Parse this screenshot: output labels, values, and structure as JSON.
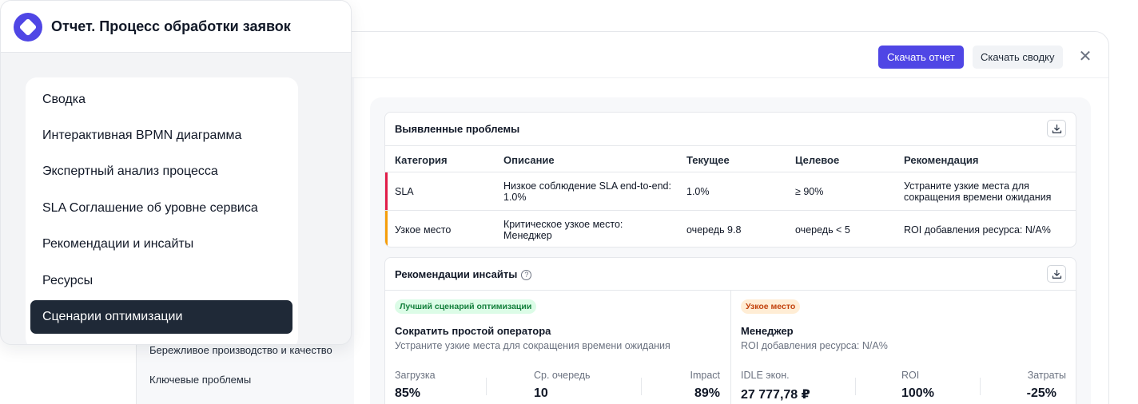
{
  "menu": {
    "title": "Отчет. Процесс обработки заявок",
    "items": [
      {
        "label": "Сводка"
      },
      {
        "label": "Интерактивная BPMN диаграмма"
      },
      {
        "label": "Экспертный анализ процесса"
      },
      {
        "label": "SLA Соглашение об уровне сервиса"
      },
      {
        "label": "Рекомендации и инсайты"
      },
      {
        "label": "Ресурсы"
      },
      {
        "label": "Сценарии оптимизации",
        "active": true
      }
    ]
  },
  "toolbar": {
    "download_report": "Скачать отчет",
    "download_summary": "Скачать сводку",
    "close": "✕"
  },
  "sub_nav": {
    "items": [
      "Бережливое производство и качество",
      "Ключевые проблемы"
    ]
  },
  "problems": {
    "title": "Выявленные проблемы",
    "headers": [
      "Категория",
      "Описание",
      "Текущее",
      "Целевое",
      "Рекомендация"
    ],
    "rows": [
      {
        "category": "SLA",
        "description": "Низкое соблюдение SLA end-to-end: 1.0%",
        "current": "1.0%",
        "target": "≥ 90%",
        "recommendation": "Устраните узкие места для сокращения времени ожидания",
        "accent": "#e11d48"
      },
      {
        "category": "Узкое место",
        "description": "Критическое узкое место: Менеджер",
        "current": "очередь 9.8",
        "target": "очередь < 5",
        "recommendation": "ROI добавления ресурса: N/A%",
        "accent": "#f59e0b"
      }
    ]
  },
  "insights": {
    "title": "Рекомендации инсайты",
    "help": "?",
    "left": {
      "badge": "Лучший сценарий оптимизации",
      "title": "Сократить простой оператора",
      "subtitle": "Устраните узкие места для сокращения времени ожидания",
      "metrics": [
        {
          "label": "Загрузка",
          "value": "85%"
        },
        {
          "label": "Ср. очередь",
          "value": "10"
        },
        {
          "label": "Impact",
          "value": "89%"
        }
      ]
    },
    "right": {
      "badge": "Узкое место",
      "title": "Менеджер",
      "subtitle": "ROI добавления ресурса: N/A%",
      "metrics": [
        {
          "label": "IDLE экон.",
          "value": "27 777,78 ₽"
        },
        {
          "label": "ROI",
          "value": "100%"
        },
        {
          "label": "Затраты",
          "value": "-25%"
        }
      ]
    }
  },
  "colors": {
    "accent": "#4f46e5",
    "sla_bar": "#e11d48",
    "bottleneck_bar": "#f59e0b"
  }
}
